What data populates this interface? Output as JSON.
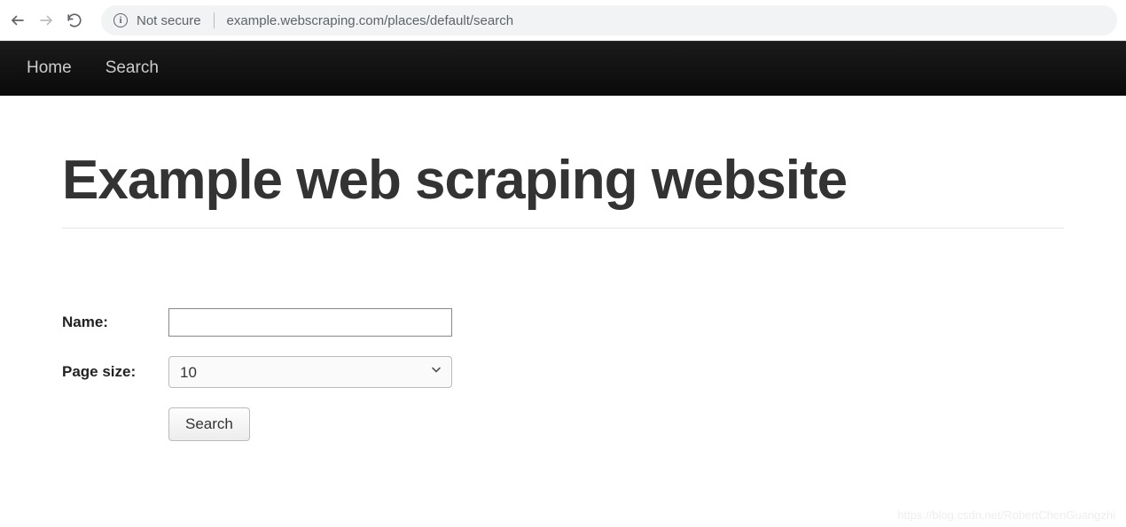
{
  "browser": {
    "security_label": "Not secure",
    "url": "example.webscraping.com/places/default/search"
  },
  "nav": {
    "home": "Home",
    "search": "Search"
  },
  "page": {
    "title": "Example web scraping website"
  },
  "form": {
    "name_label": "Name:",
    "name_value": "",
    "page_size_label": "Page size:",
    "page_size_value": "10",
    "search_button": "Search"
  },
  "watermark": "https://blog.csdn.net/RobertChenGuangzhi"
}
